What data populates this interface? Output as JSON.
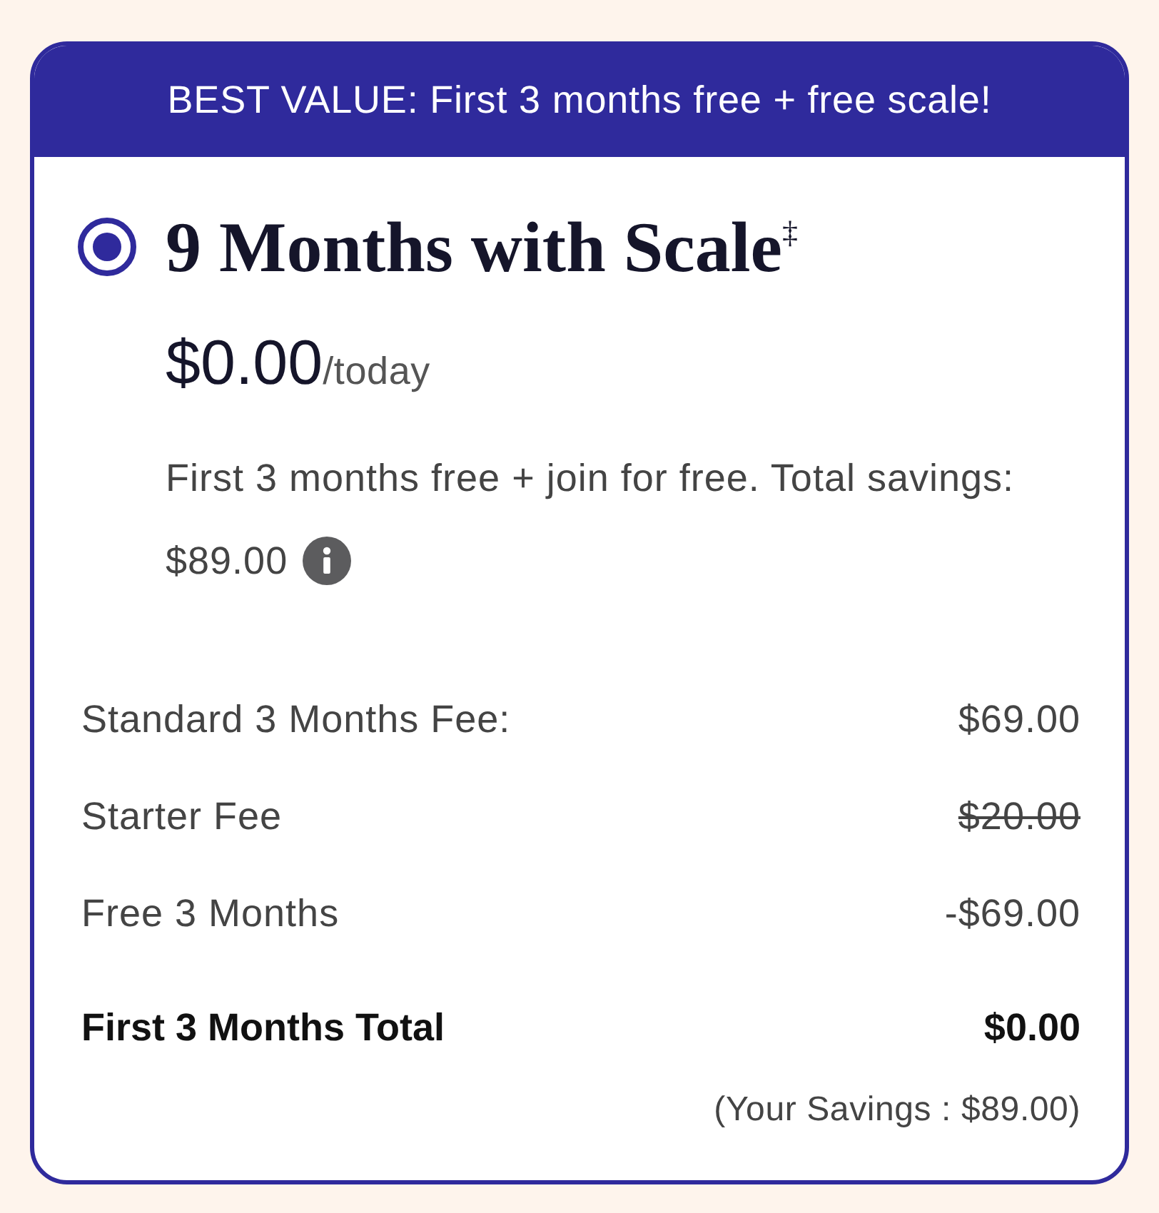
{
  "banner": {
    "text": "BEST VALUE: First 3 months free + free scale!"
  },
  "plan": {
    "selected": true,
    "title": "9 Months with Scale$^{‡}$",
    "price": "$0.00",
    "price_period": "/today",
    "description": "First 3 months free + join for free. Total savings:",
    "savings_amount": "$89.00"
  },
  "line_items": [
    {
      "label": "Standard 3 Months Fee:",
      "amount": "$69.00",
      "struck": false
    },
    {
      "label": "Starter Fee",
      "amount": "$20.00",
      "struck": true
    },
    {
      "label": "Free 3 Months",
      "amount": "-$69.00",
      "struck": false
    }
  ],
  "total": {
    "label": "First 3 Months Total",
    "amount": "$0.00"
  },
  "savings_note": "(Your Savings : $89.00)"
}
